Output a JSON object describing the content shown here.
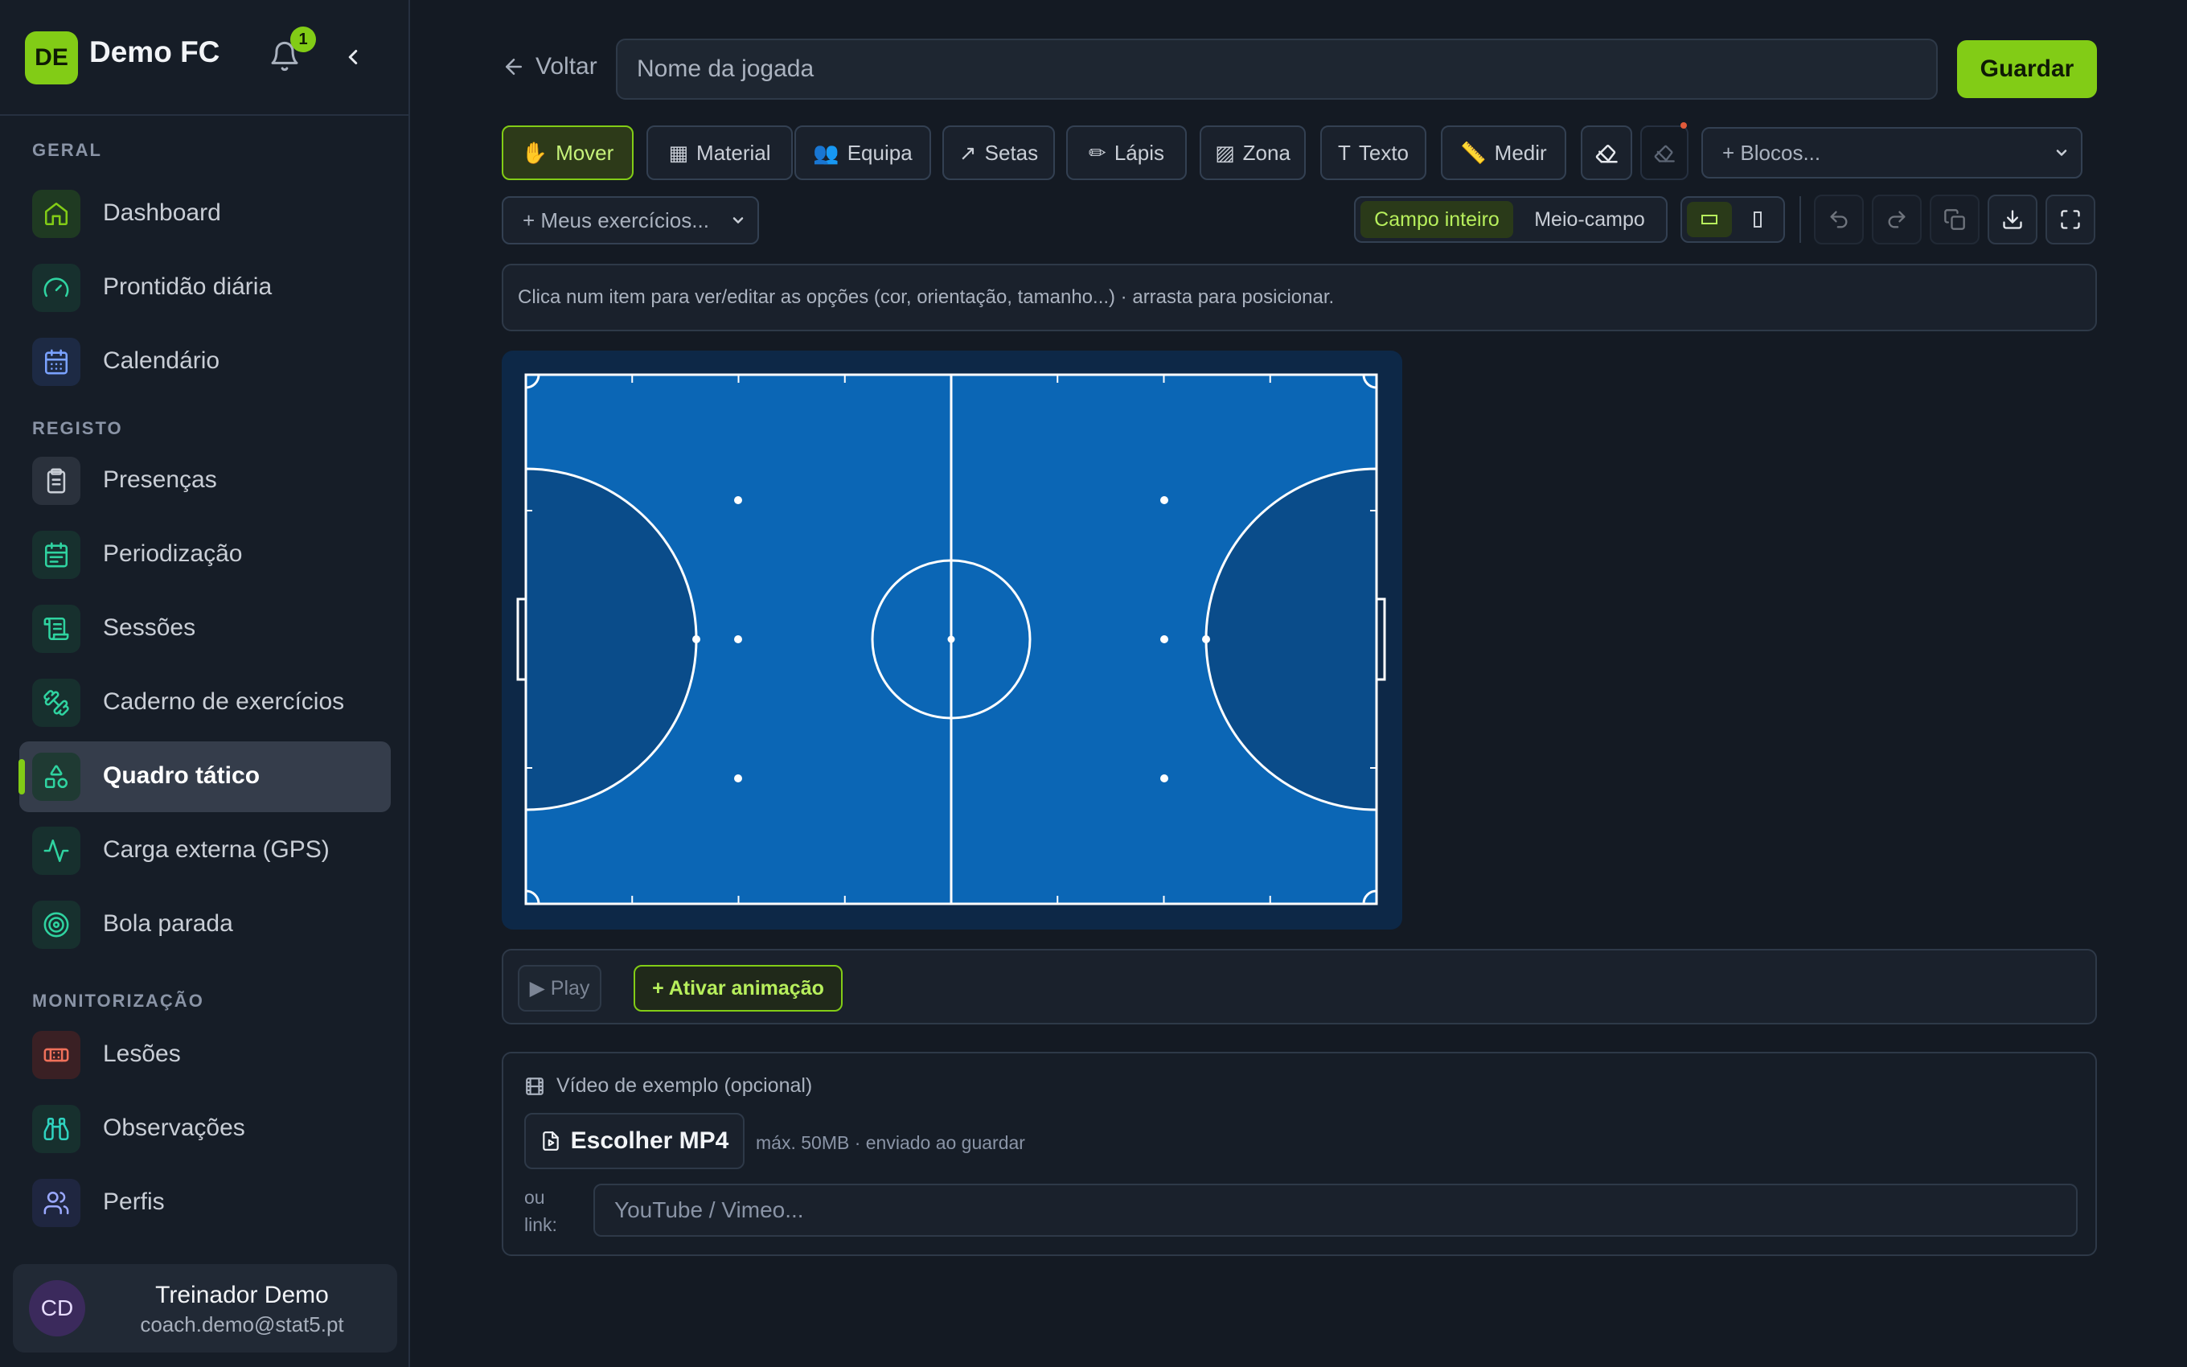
{
  "brand": {
    "initials": "DE",
    "name": "Demo FC",
    "notifications": "1"
  },
  "sidebar": {
    "sections": [
      {
        "title": "GERAL"
      },
      {
        "title": "REGISTO"
      },
      {
        "title": "MONITORIZAÇÃO"
      }
    ],
    "items": [
      {
        "label": "Dashboard",
        "icon": "home-icon",
        "color": "#82cc16",
        "bg": "#1f3a22"
      },
      {
        "label": "Prontidão diária",
        "icon": "gauge-icon",
        "color": "#2fd3a0",
        "bg": "#17302e"
      },
      {
        "label": "Calendário",
        "icon": "calendar-icon",
        "color": "#7aa2ff",
        "bg": "#1d2a44"
      },
      {
        "label": "Presenças",
        "icon": "clipboard-icon",
        "color": "#c9ced6",
        "bg": "#2a313c"
      },
      {
        "label": "Periodização",
        "icon": "calendar-range-icon",
        "color": "#2fd3a0",
        "bg": "#17302e"
      },
      {
        "label": "Sessões",
        "icon": "scroll-icon",
        "color": "#2fd3a0",
        "bg": "#17302e"
      },
      {
        "label": "Caderno de exercícios",
        "icon": "dumbbell-icon",
        "color": "#2fd3a0",
        "bg": "#17302e"
      },
      {
        "label": "Quadro tático",
        "icon": "shapes-icon",
        "color": "#2fd3a0",
        "bg": "#1f3a33"
      },
      {
        "label": "Carga externa (GPS)",
        "icon": "activity-icon",
        "color": "#2fd3a0",
        "bg": "#17302e"
      },
      {
        "label": "Bola parada",
        "icon": "target-icon",
        "color": "#2fd3a0",
        "bg": "#17302e"
      },
      {
        "label": "Lesões",
        "icon": "bandage-icon",
        "color": "#f0705a",
        "bg": "#3a2024"
      },
      {
        "label": "Observações",
        "icon": "binoculars-icon",
        "color": "#2fd3c0",
        "bg": "#17302e"
      },
      {
        "label": "Perfis",
        "icon": "users-icon",
        "color": "#9aa8ff",
        "bg": "#1f2640"
      }
    ],
    "user": {
      "initials": "CD",
      "name": "Treinador Demo",
      "email": "coach.demo@stat5.pt"
    }
  },
  "header": {
    "back_label": "Voltar",
    "name_placeholder": "Nome da jogada",
    "save_label": "Guardar"
  },
  "toolbar": {
    "tools": [
      {
        "label": "Mover",
        "icon": "hand-icon",
        "glyph": "✋"
      },
      {
        "label": "Material",
        "icon": "grid-icon",
        "glyph": "▦"
      },
      {
        "label": "Equipa",
        "icon": "team-icon",
        "glyph": "👥"
      },
      {
        "label": "Setas",
        "icon": "arrow-icon",
        "glyph": "↗"
      },
      {
        "label": "Lápis",
        "icon": "pencil-icon",
        "glyph": "✏"
      },
      {
        "label": "Zona",
        "icon": "zone-icon",
        "glyph": "▨"
      },
      {
        "label": "Texto",
        "icon": "text-icon",
        "glyph": "T"
      },
      {
        "label": "Medir",
        "icon": "ruler-icon",
        "glyph": "📏"
      }
    ],
    "blocks_label": "+ Blocos...",
    "exercises_label": "+ Meus exercícios...",
    "field_modes": [
      "Campo inteiro",
      "Meio-campo"
    ]
  },
  "hint": "Clica num item para ver/editar as opções (cor, orientação, tamanho...) · arrasta para posicionar.",
  "pitch": {
    "surface_color": "#0b66b5",
    "area_color": "#0a4c8a",
    "line_color": "#ffffff"
  },
  "animation": {
    "play_label": "▶ Play",
    "activate_label": "+ Ativar animação"
  },
  "video": {
    "title": "Vídeo de exemplo (opcional)",
    "choose_label": "Escolher MP4",
    "note": "máx. 50MB · enviado ao guardar",
    "or_label": "ou link:",
    "link_placeholder": "YouTube / Vimeo..."
  }
}
